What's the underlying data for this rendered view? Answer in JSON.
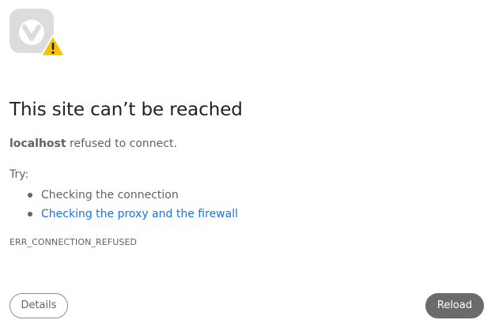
{
  "error": {
    "icon": "vivaldi-logo-warning-icon",
    "title": "This site can’t be reached",
    "host": "localhost",
    "message_suffix": " refused to connect.",
    "try_label": "Try:",
    "suggestions": [
      {
        "label": "Checking the connection",
        "is_link": false
      },
      {
        "label": "Checking the proxy and the firewall",
        "is_link": true
      }
    ],
    "code": "ERR_CONNECTION_REFUSED"
  },
  "buttons": {
    "details_label": "Details",
    "reload_label": "Reload"
  },
  "colors": {
    "text": "#5f6368",
    "title": "#202124",
    "link": "#1a73e8",
    "reload_bg": "#6b6b6b",
    "logo_bg": "#dcdcdc",
    "warning": "#f5c400"
  }
}
